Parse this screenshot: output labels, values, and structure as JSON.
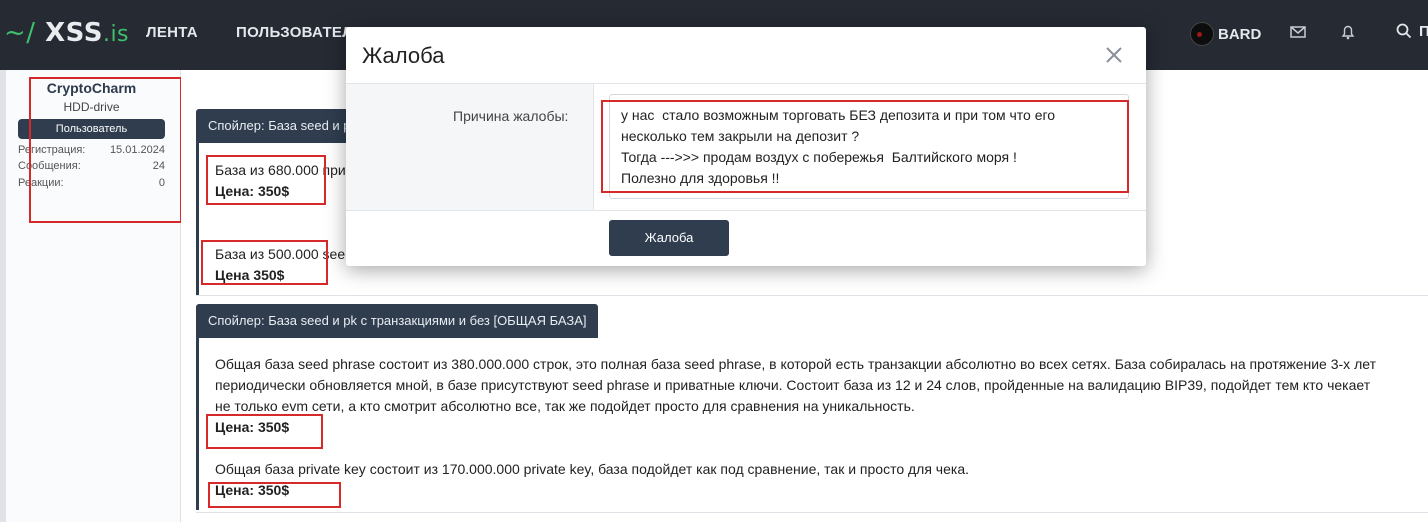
{
  "nav": {
    "logo_prefix": "~/",
    "logo_main": "XSS",
    "logo_suffix": ".is",
    "items": [
      "ЛЕНТА",
      "ПОЛЬЗОВАТЕЛ"
    ],
    "username": "BARD",
    "search_label": "П",
    "icons": [
      "mail-icon",
      "bell-icon",
      "search-icon"
    ]
  },
  "sidebar": {
    "username": "CryptoCharm",
    "user_title": "HDD-drive",
    "badge": "Пользователь",
    "stats": [
      {
        "label": "Регистрация:",
        "value": "15.01.2024"
      },
      {
        "label": "Сообщения:",
        "value": "24"
      },
      {
        "label": "Реакции:",
        "value": "0"
      }
    ]
  },
  "post": {
    "spoiler1_label": "Спойлер: База seed и р",
    "block1_line": "База из 680.000 при",
    "block1_price": "Цена: 350$",
    "block2_line": "База из 500.000 see",
    "block2_price": "Цена 350$",
    "spoiler2_label": "Спойлер: База seed и pk с транзакциями и без [ОБЩАЯ БАЗА]",
    "desc_lines": [
      "Общая база seed phrase состоит из 380.000.000 строк, это полная база seed phrase, в которой есть транзакции абсолютно во всех сетях. База собиралась на протяжение 3-х лет",
      "периодически обновляется мной, в базе присутствуют seed phrase и приватные ключи. Состоит база из 12 и 24 слов, пройденные на валидацию BIP39, подойдет тем кто чекает",
      "не только evm сети, а кто смотрит абсолютно все, так же подойдет просто для сравнения на уникальность."
    ],
    "price3": "Цена: 350$",
    "private_line": "Общая база private key состоит из 170.000.000 private key, база подойдет как под сравнение, так и просто для чека.",
    "price4": "Цена: 350$"
  },
  "modal": {
    "title": "Жалоба",
    "reason_label": "Причина жалобы:",
    "reason_text": "у нас  стало возможным торговать БЕЗ депозита и при том что его\nнесколько тем закрыли на депозит ?\nТогда --->>> продам воздух с побережья  Балтийского моря !\nПолезно для здоровья !!",
    "submit_label": "Жалоба"
  },
  "colors": {
    "nav_bg": "#252a33",
    "accent_green": "#3fbf6a",
    "button_dark": "#2f3d4f",
    "highlight_red": "#d62a2a"
  }
}
